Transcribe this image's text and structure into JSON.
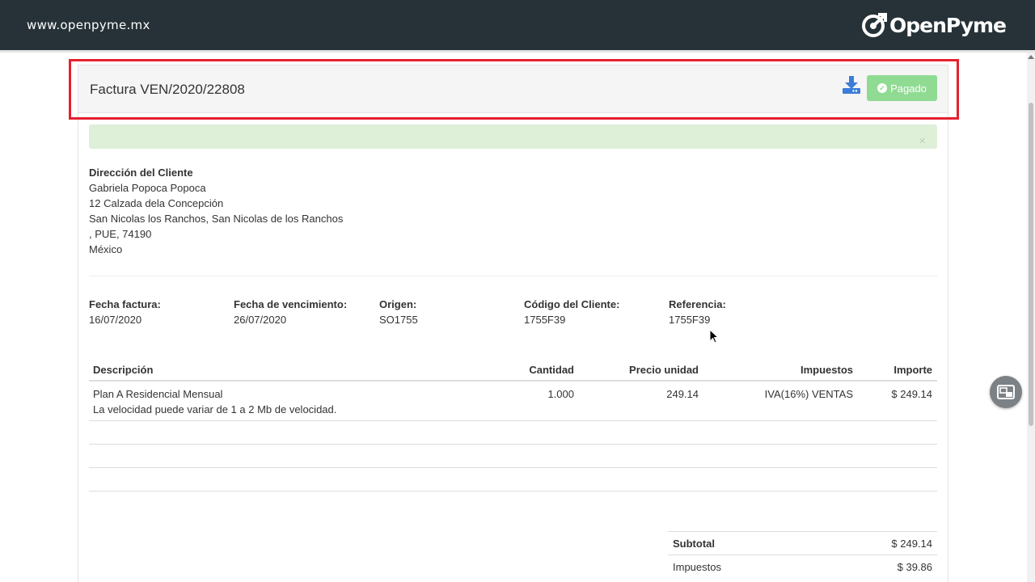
{
  "topbar": {
    "url": "www.openpyme.mx",
    "logo_text": "OpenPyme"
  },
  "invoice": {
    "title": "Factura VEN/2020/22808",
    "status_label": "Pagado",
    "download_icon": "download-icon",
    "alert_close": "×"
  },
  "address": {
    "heading": "Dirección del Cliente",
    "lines": [
      "Gabriela Popoca Popoca",
      "12 Calzada dela Concepción",
      "San Nicolas los Ranchos, San Nicolas de los Ranchos",
      ", PUE, 74190",
      "México"
    ]
  },
  "meta": [
    {
      "label": "Fecha factura:",
      "value": "16/07/2020"
    },
    {
      "label": "Fecha de vencimiento:",
      "value": "26/07/2020"
    },
    {
      "label": "Origen:",
      "value": "SO1755"
    },
    {
      "label": "Código del Cliente:",
      "value": "1755F39"
    },
    {
      "label": "Referencia:",
      "value": "1755F39"
    }
  ],
  "table": {
    "headers": {
      "description": "Descripción",
      "quantity": "Cantidad",
      "unit_price": "Precio unidad",
      "taxes": "Impuestos",
      "amount": "Importe"
    },
    "rows": [
      {
        "description": "Plan A Residencial Mensual",
        "note": "La velocidad puede variar de 1 a 2 Mb de velocidad.",
        "quantity": "1.000",
        "unit_price": "249.14",
        "taxes": "IVA(16%) VENTAS",
        "amount": "$ 249.14"
      }
    ]
  },
  "totals": {
    "subtotal_label": "Subtotal",
    "subtotal_value": "$ 249.14",
    "taxes_label": "Impuestos",
    "taxes_value": "$ 39.86"
  },
  "colors": {
    "topbar": "#263238",
    "paid": "#8fdb92",
    "alert": "#dff0d8",
    "highlight": "#e5202e",
    "download": "#3b7dd8"
  }
}
